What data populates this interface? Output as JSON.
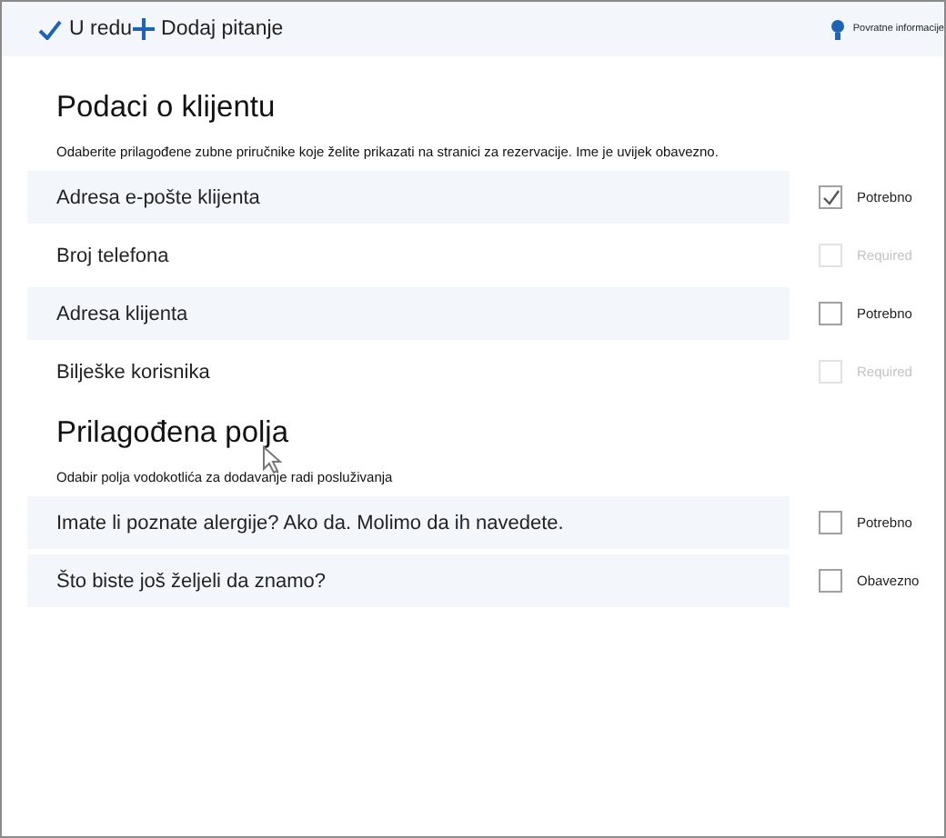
{
  "toolbar": {
    "actions": [
      {
        "kind": "check",
        "label": "U redu"
      },
      {
        "kind": "plus",
        "label": "Dodaj pitanje"
      }
    ],
    "feedback": "Povratne informacije"
  },
  "sections": [
    {
      "title": "Podaci o klijentu",
      "description": "Odaberite prilagođene zubne priručnike koje želite prikazati na stranici za rezervacije. Ime je uvijek obavezno.",
      "fields": [
        {
          "label": "Adresa e-pošte klijenta",
          "checked": true,
          "disabled": false,
          "option": "Potrebno"
        },
        {
          "label": "Broj telefona",
          "checked": false,
          "disabled": true,
          "option": "Required"
        },
        {
          "label": "Adresa klijenta",
          "checked": false,
          "disabled": false,
          "option": "Potrebno"
        },
        {
          "label": "Bilješke korisnika",
          "checked": false,
          "disabled": true,
          "option": "Required"
        }
      ]
    },
    {
      "title": "Prilagođena polja",
      "description": "Odabir polja vodokotlića za dodavanje radi posluživanja",
      "fields": [
        {
          "label": "Imate li poznate alergije? Ako da. Molimo da ih navedete.",
          "checked": false,
          "disabled": false,
          "option": "Potrebno"
        },
        {
          "label": "Što biste još željeli da znamo?",
          "checked": false,
          "disabled": false,
          "option": "Obavezno"
        }
      ]
    }
  ]
}
